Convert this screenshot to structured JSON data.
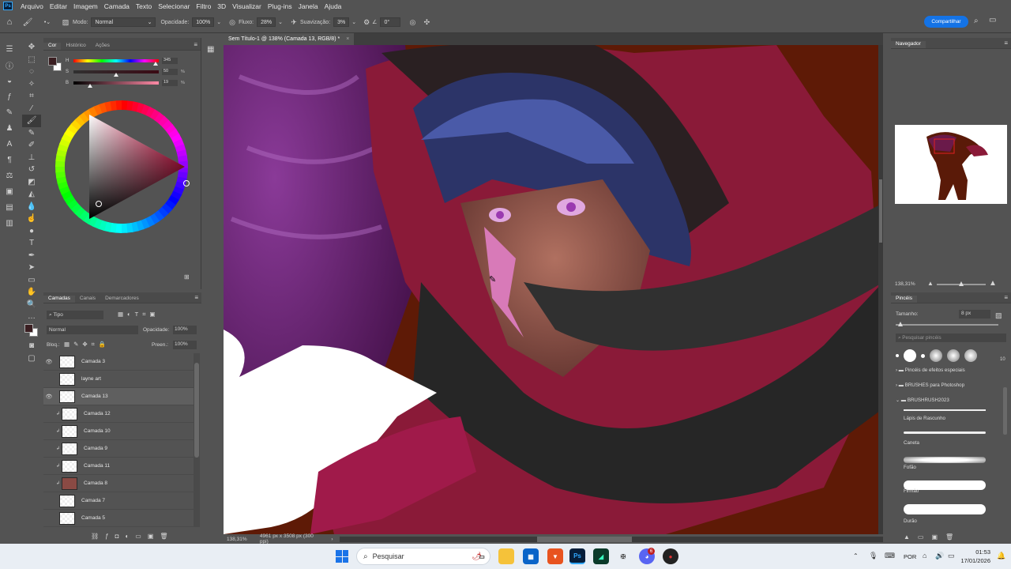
{
  "menu": [
    "Arquivo",
    "Editar",
    "Imagem",
    "Camada",
    "Texto",
    "Selecionar",
    "Filtro",
    "3D",
    "Visualizar",
    "Plug-ins",
    "Janela",
    "Ajuda"
  ],
  "ps_logo": "Ps",
  "options": {
    "mode_label": "Modo:",
    "mode_value": "Normal",
    "opacity_label": "Opacidade:",
    "opacity_value": "100%",
    "flow_label": "Fluxo:",
    "flow_value": "28%",
    "smoothing_label": "Suavização:",
    "smoothing_value": "3%",
    "angle_value": "0°",
    "share_label": "Compartilhar"
  },
  "color_panel": {
    "tabs": [
      "Cor",
      "Histórico",
      "Ações"
    ],
    "h_label": "H",
    "h_value": "345",
    "s_label": "S",
    "s_value": "50",
    "s_unit": "%",
    "b_label": "B",
    "b_value": "19",
    "b_unit": "%",
    "h_level": 0.96,
    "s_level": 0.5,
    "b_level": 0.19
  },
  "layers_panel": {
    "tabs": [
      "Camadas",
      "Canais",
      "Demarcadores"
    ],
    "filter_label": "Tipo",
    "blend_mode": "Normal",
    "opacity_label": "Opacidade:",
    "opacity_value": "100%",
    "lock_label": "Bloq.:",
    "fill_label": "Preen.:",
    "fill_value": "100%",
    "layers": [
      {
        "name": "Camada 3",
        "visible": true,
        "clip": false,
        "selected": false
      },
      {
        "name": "layne art",
        "visible": false,
        "clip": false,
        "selected": false
      },
      {
        "name": "Camada 13",
        "visible": true,
        "clip": false,
        "selected": true
      },
      {
        "name": "Camada 12",
        "visible": false,
        "clip": true,
        "selected": false
      },
      {
        "name": "Camada 10",
        "visible": false,
        "clip": true,
        "selected": false
      },
      {
        "name": "Camada 9",
        "visible": false,
        "clip": true,
        "selected": false
      },
      {
        "name": "Camada 11",
        "visible": false,
        "clip": true,
        "selected": false
      },
      {
        "name": "Camada 8",
        "visible": false,
        "clip": true,
        "selected": false
      },
      {
        "name": "Camada 7",
        "visible": false,
        "clip": false,
        "selected": false
      },
      {
        "name": "Camada 5",
        "visible": false,
        "clip": false,
        "selected": false
      }
    ]
  },
  "document": {
    "tab_title": "Sem Título-1 @ 138% (Camada 13, RGB/8) *",
    "zoom": "138,31%",
    "dimensions": "4961 px x 3508 px (300 ppi)"
  },
  "navigator": {
    "title": "Navegador",
    "zoom": "138,31%"
  },
  "brushes": {
    "title": "Pincéis",
    "size_label": "Tamanho:",
    "size_value": "8 px",
    "search_placeholder": "Pesquisar pincéis",
    "preset_count": "10",
    "folders": [
      "Pincéis de efeitos especiais",
      "BRUSHES para Photoshop",
      "BRUSHRUSH2023"
    ],
    "items": [
      "Lápis de Rascunho",
      "Caneta",
      "Fofão",
      "Firmão",
      "Durão"
    ]
  },
  "taskbar": {
    "search_placeholder": "Pesquisar",
    "language": "POR",
    "time": "01:53",
    "date": "17/01/2026",
    "discord_badge": "6"
  },
  "colors": {
    "foreground": "#3a1e21",
    "background": "#ffffff",
    "accent": "#1473e6"
  }
}
